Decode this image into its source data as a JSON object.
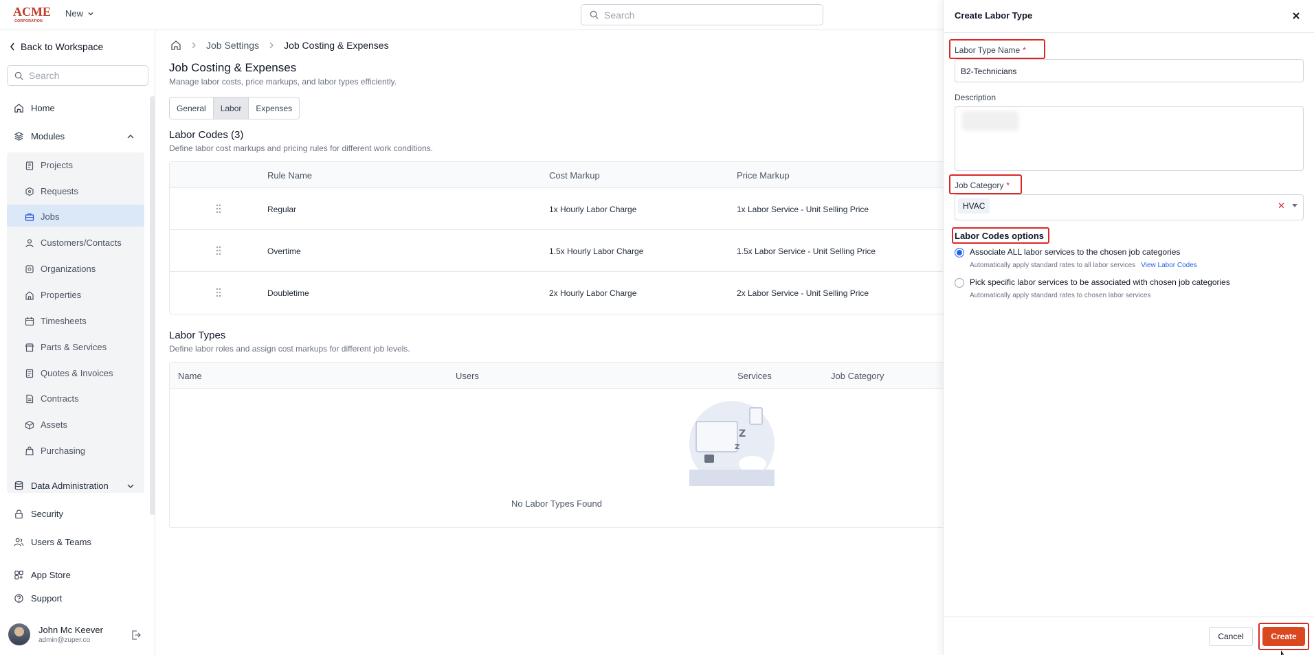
{
  "topbar": {
    "logo_text": "ACME",
    "logo_subtext": "CORPORATION",
    "new_label": "New",
    "search_placeholder": "Search"
  },
  "sidebar": {
    "back_label": "Back to Workspace",
    "search_placeholder": "Search",
    "home": "Home",
    "modules": "Modules",
    "module_items": [
      "Projects",
      "Requests",
      "Jobs",
      "Customers/Contacts",
      "Organizations",
      "Properties",
      "Timesheets",
      "Parts & Services",
      "Quotes & Invoices",
      "Contracts",
      "Assets",
      "Purchasing"
    ],
    "active_item": "Jobs",
    "data_admin": "Data Administration",
    "security": "Security",
    "users_teams": "Users & Teams",
    "app_store": "App Store",
    "support": "Support",
    "user": {
      "name": "John Mc Keever",
      "email": "admin@zuper.co"
    }
  },
  "main": {
    "breadcrumbs": [
      "Job Settings",
      "Job Costing & Expenses"
    ],
    "title": "Job Costing & Expenses",
    "subtitle": "Manage labor costs, price markups, and labor types efficiently.",
    "tabs": [
      "General",
      "Labor",
      "Expenses"
    ],
    "active_tab": "Labor",
    "labor_codes": {
      "title": "Labor Codes (3)",
      "subtitle": "Define labor cost markups and pricing rules for different work conditions.",
      "columns": [
        "Rule Name",
        "Cost Markup",
        "Price Markup"
      ],
      "rows": [
        [
          "Regular",
          "1x Hourly Labor Charge",
          "1x Labor Service - Unit Selling Price"
        ],
        [
          "Overtime",
          "1.5x Hourly Labor Charge",
          "1.5x Labor Service - Unit Selling Price"
        ],
        [
          "Doubletime",
          "2x Hourly Labor Charge",
          "2x Labor Service - Unit Selling Price"
        ]
      ]
    },
    "labor_types": {
      "title": "Labor Types",
      "subtitle": "Define labor roles and assign cost markups for different job levels.",
      "columns": [
        "Name",
        "Users",
        "Services",
        "Job Category"
      ],
      "empty_text": "No Labor Types Found"
    }
  },
  "panel": {
    "title": "Create Labor Type",
    "name_label": "Labor Type Name",
    "name_value": "B2-Technicians",
    "required_mark": "*",
    "description_label": "Description",
    "category_label": "Job Category",
    "category_value": "HVAC",
    "options_title": "Labor Codes options",
    "option1_label": "Associate ALL labor services to the chosen job categories",
    "option1_sub": "Automatically apply standard rates to all labor services",
    "option1_link": "View Labor Codes",
    "option2_label": "Pick specific labor services to be associated with chosen job categories",
    "option2_sub": "Automatically apply standard rates to chosen labor services",
    "selected_option": 1,
    "cancel_label": "Cancel",
    "create_label": "Create"
  },
  "colors": {
    "accent": "#d9481f",
    "highlight": "#dc2626",
    "link": "#2563eb",
    "active_nav": "#dbe8f8"
  }
}
